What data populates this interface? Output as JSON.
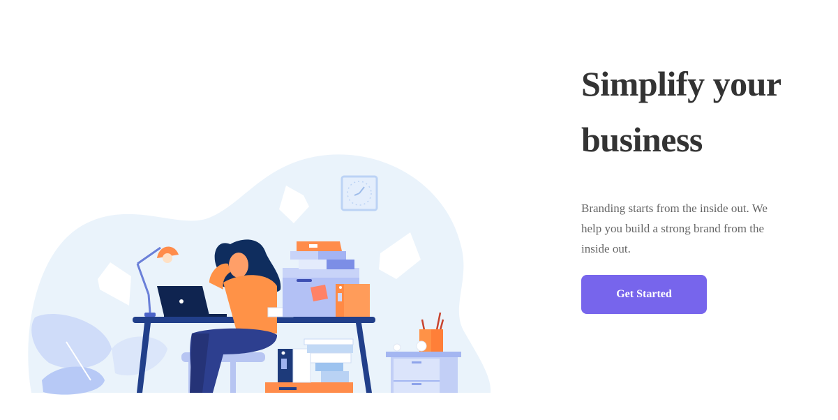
{
  "hero": {
    "headline_line1": "Simplify your",
    "headline_line2": "business",
    "description": "Branding starts from the inside out. We help you build a strong brand from the inside out.",
    "cta_label": "Get Started"
  },
  "illustration": {
    "subject": "office-worker-at-desk-illustration"
  },
  "colors": {
    "accent": "#7765ec",
    "heading": "#333333",
    "body_text": "#666666",
    "blob": "#eaf3fb",
    "orange": "#ff8c4b",
    "navy": "#1d3a7a"
  }
}
